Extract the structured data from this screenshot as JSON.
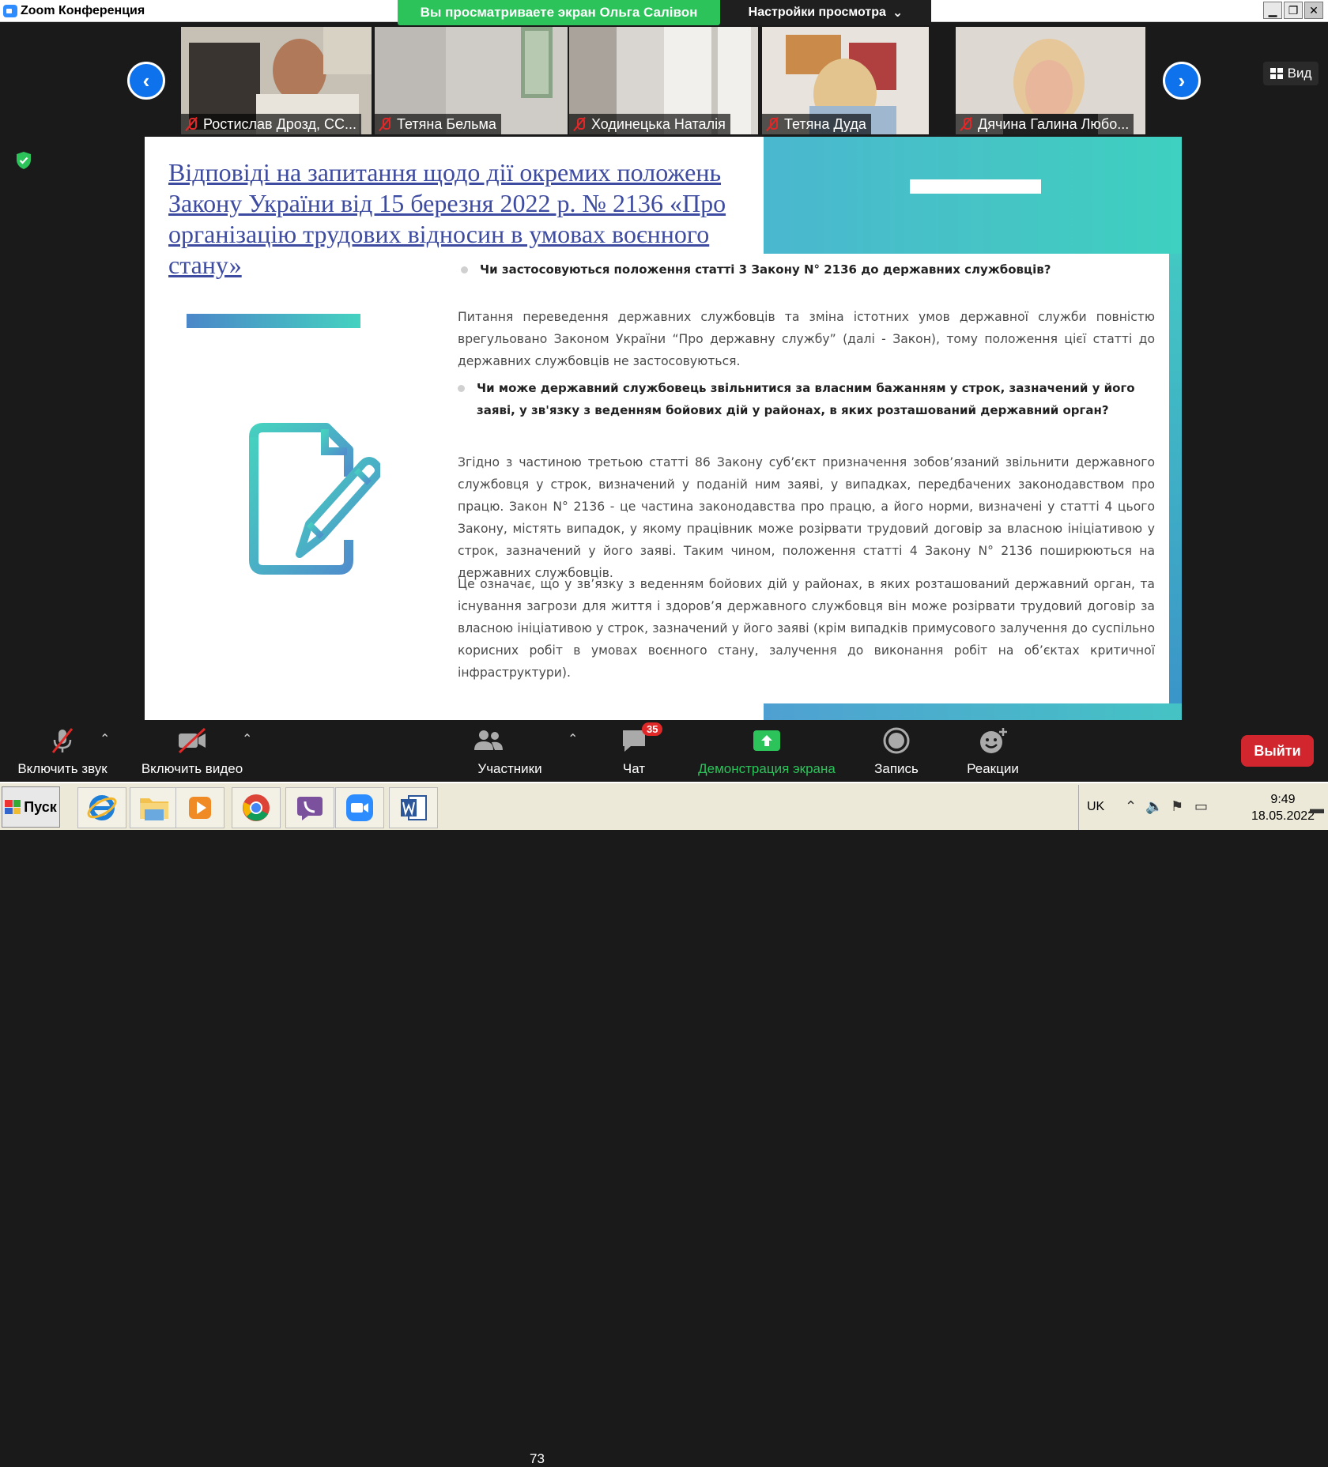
{
  "titlebar": {
    "app_title": "Zoom Конференция",
    "share_banner": "Вы просматриваете экран Ольга Салівон",
    "view_settings": "Настройки просмотра",
    "view_settings_caret": "⌄",
    "win_min": "▁",
    "win_max": "❐",
    "win_close": "✕"
  },
  "gallery": {
    "participants": [
      {
        "name": "Ростислав Дрозд, СС..."
      },
      {
        "name": "Тетяна Бельма"
      },
      {
        "name": "Ходинецька Наталія"
      },
      {
        "name": "Тетяна Дуда"
      },
      {
        "name": "Дячина Галина Любо..."
      }
    ],
    "prev_arrow": "‹",
    "next_arrow": "›",
    "view_button": "Вид"
  },
  "slide": {
    "title": "Відповіді на запитання щодо дії окремих положень Закону України від 15 березня 2022 р. № 2136 «Про організацію трудових відносин в умовах воєнного стану»",
    "q1": "Чи застосовуються положення статті 3 Закону N° 2136 до державних службовців?",
    "p1": "Питання переведення державних службовців та зміна істотних умов державної служби повністю врегульовано Законом України “Про державну службу” (далі - Закон), тому положення цієї статті до державних службовців не застосовуються.",
    "q2": "Чи може державний службовець звільнитися за власним бажанням у строк, зазначений у його заяві, у зв'язку з веденням бойових дій у районах, в яких розташований державний орган?",
    "p2": "Згідно з частиною третьою статті 86 Закону суб’єкт призначення зобов’язаний звільнити державного службовця у строк, визначений у поданій ним заяві, у випадках, передбачених законодавством про працю. Закон N° 2136 - це частина законодавства про працю, а його норми, визначені у статті 4 цього Закону, містять випадок, у якому працівник може розірвати трудовий договір за власною ініціативою у строк, зазначений у його заяві. Таким чином, положення статті 4 Закону N° 2136 поширюються на державних службовців.",
    "p3": "Це означає, що у зв’язку з веденням бойових дій у районах, в яких розташований державний орган, та існування загрози для життя і здоров’я державного службовця він може розірвати трудовий договір за власною ініціативою у строк, зазначений у його заяві (крім випадків примусового залучення до суспільно корисних робіт в умовах воєнного стану, залучення до виконання робіт на об’єктах критичної інфраструктури)."
  },
  "toolbar": {
    "unmute": "Включить звук",
    "start_video": "Включить видео",
    "participants": "Участники",
    "participants_count": "73",
    "chat": "Чат",
    "chat_badge": "35",
    "share": "Демонстрация экрана",
    "record": "Запись",
    "reactions": "Реакции",
    "leave": "Выйти",
    "caret": "⌃"
  },
  "taskbar": {
    "start": "Пуск",
    "lang": "UK",
    "time": "9:49",
    "date": "18.05.2022"
  },
  "colors": {
    "zoom_blue": "#0e72ed",
    "share_green": "#2bc35a",
    "leave_red": "#d1262e",
    "teal": "#45c6c4"
  }
}
